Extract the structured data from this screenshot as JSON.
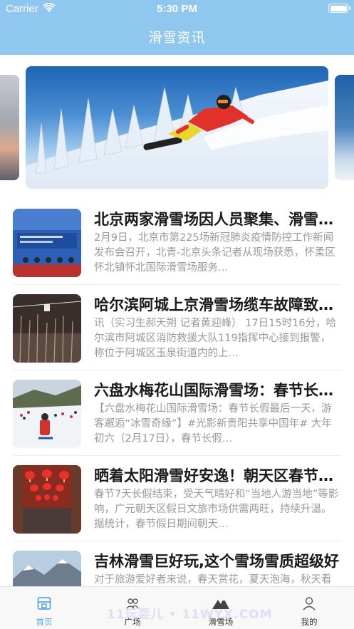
{
  "status_bar": {
    "carrier": "Carrier",
    "time": "5:30 PM"
  },
  "nav": {
    "title": "滑雪资讯"
  },
  "banner": {
    "icon": "snowboarder-image"
  },
  "news": [
    {
      "title": "北京两家滑雪场因人员聚集、滑雪场暂停营业",
      "desc": "2月9日，北京市第225场新冠肺炎疫情防控工作新闻发布会召开，北青-北京头条记者从现场获悉，怀柔区怀北镇怀北国际滑雪场服务…",
      "thumb": "press-conference-thumb"
    },
    {
      "title": "哈尔滨阿城上京滑雪场缆车故障致游客被困",
      "desc": "讯（实习生郝天朔 记者黄迎峰） 17日15时16分，哈尔滨市阿城区消防救援大队119指挥中心接到报警，称位于阿城区玉泉街道内的上…",
      "thumb": "ski-lift-night-thumb"
    },
    {
      "title": "六盘水梅花山国际滑雪场：春节长假最后一天",
      "desc": "【六盘水梅花山国际滑雪场：春节长假最后一天，游客邂逅“冰雪奇缘”】#光影新贵阳共享中国年# 大年初六（2月17日），春节长假…",
      "thumb": "ski-resort-crowd-thumb"
    },
    {
      "title": "晒着太阳滑雪好安逸！朝天区春节假日文旅市场",
      "desc": "春节7天长假结束，受天气晴好和“当地人游当地”等影响，广元朝天区假日文旅市场供需两旺，持续升温。据统计，春节假日期间朝天…",
      "thumb": "red-lanterns-thumb"
    },
    {
      "title": "吉林滑雪巨好玩,这个雪场雪质超级好",
      "desc": "对于旅游爱好者来说，春天赏花，夏天泡海，秋天看叶，冬天滑雪，吉林…",
      "thumb": "mountain-snow-thumb"
    }
  ],
  "tabbar": {
    "tabs": [
      {
        "label": "首页",
        "icon": "home-icon",
        "active": true
      },
      {
        "label": "广场",
        "icon": "people-icon",
        "active": false
      },
      {
        "label": "滑雪场",
        "icon": "mountain-icon",
        "active": false
      },
      {
        "label": "我的",
        "icon": "user-icon",
        "active": false
      }
    ],
    "watermark": "11玩耍儿 • 11WYX.COM"
  },
  "colors": {
    "header": "#8fc7ee",
    "accent": "#5ba7e6",
    "title_text": "#1a1a1a",
    "desc_text": "#9a9a9a"
  }
}
